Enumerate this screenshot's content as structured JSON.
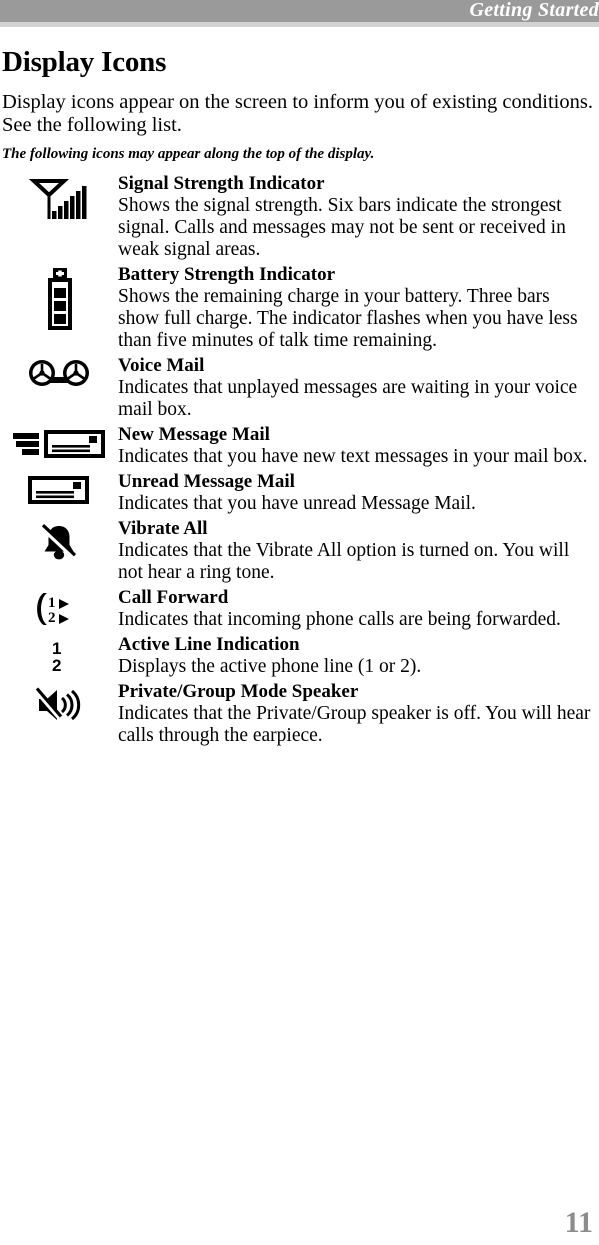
{
  "header": {
    "running_title": "Getting Started",
    "band_color": "#9a9a9a",
    "band_under_color": "#d2d2d2",
    "title_color": "#ffffff"
  },
  "page": {
    "title": "Display Icons",
    "intro": "Display icons appear on the screen to inform you of existing conditions. See the following list.",
    "subintro": "The following icons may appear along the top of the display.",
    "page_number": "11",
    "page_number_color": "#8c8c8c"
  },
  "icons": [
    {
      "icon": "signal-strength-icon",
      "title": "Signal Strength Indicator",
      "description": "Shows the signal strength. Six bars indicate the strongest signal. Calls and messages may not be sent or received in weak signal areas."
    },
    {
      "icon": "battery-strength-icon",
      "title": "Battery Strength Indicator",
      "description": "Shows the remaining charge in your battery. Three bars show full charge. The indicator flashes when you have less than five minutes of talk time remaining."
    },
    {
      "icon": "voice-mail-icon",
      "title": "Voice Mail",
      "description": "Indicates that unplayed messages are waiting in your voice mail box."
    },
    {
      "icon": "new-message-mail-icon",
      "title": "New Message Mail",
      "description": "Indicates that you have new text messages in your mail box."
    },
    {
      "icon": "unread-message-mail-icon",
      "title": "Unread Message Mail",
      "description": "Indicates that you have unread Message Mail."
    },
    {
      "icon": "vibrate-all-icon",
      "title": "Vibrate All",
      "description": "Indicates that the Vibrate All option is turned on. You will not hear a ring tone."
    },
    {
      "icon": "call-forward-icon",
      "title": "Call Forward",
      "description": "Indicates that incoming phone calls are being forwarded."
    },
    {
      "icon": "active-line-icon",
      "title": "Active Line Indication",
      "description": "Displays the active phone line (1 or 2)."
    },
    {
      "icon": "private-group-speaker-icon",
      "title": "Private/Group Mode Speaker",
      "description": "Indicates that the Private/Group speaker is off. You will hear calls through the earpiece."
    }
  ],
  "icon_labels": {
    "call_forward_line1": "1",
    "call_forward_line2": "2",
    "active_line_1": "1",
    "active_line_2": "2"
  }
}
